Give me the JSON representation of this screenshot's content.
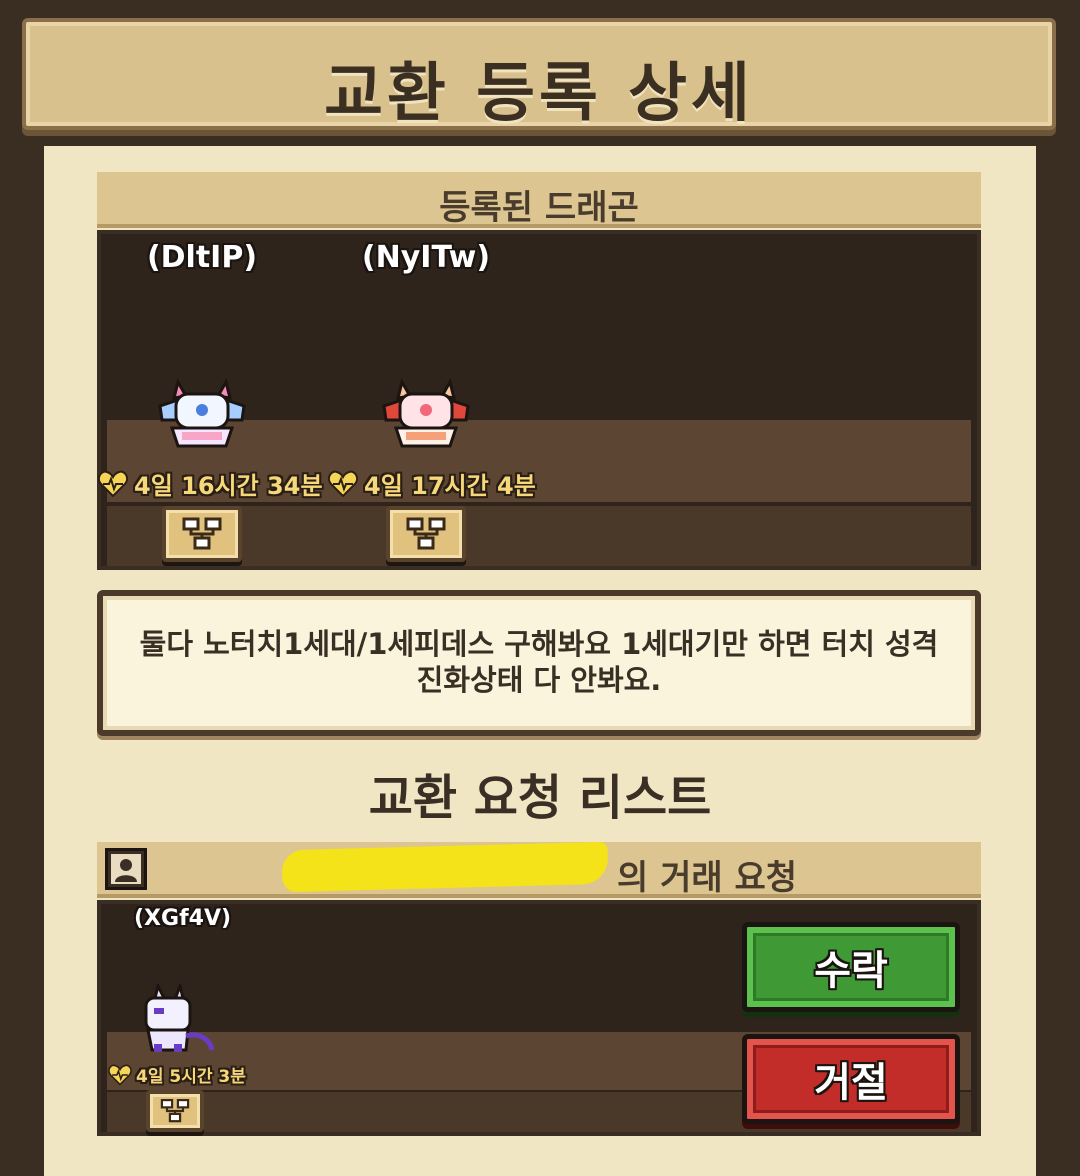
{
  "header": {
    "title": "교환 등록 상세"
  },
  "registered": {
    "section_label": "등록된 드래곤",
    "dragons": [
      {
        "name": "(DltIP)",
        "time": "4일 16시간 34분",
        "palette": "blue"
      },
      {
        "name": "(NyITw)",
        "time": "4일 17시간 4분",
        "palette": "red"
      }
    ]
  },
  "memo": {
    "text": "둘다 노터치1세대/1세피데스 구해봐요 1세대기만 하면 터치 성격 진화상태 다 안봐요."
  },
  "request_list": {
    "title": "교환 요청 리스트",
    "request": {
      "from_suffix": "의 거래 요청",
      "dragon_name": "(XGf4V)",
      "time": "4일 5시간 3분",
      "accept_label": "수락",
      "reject_label": "거절"
    }
  },
  "colors": {
    "accept": "#3f9a35",
    "reject": "#c22d2a",
    "gold_text": "#f6d77a",
    "panel": "#f1e6c4"
  },
  "icons": [
    "heart-icon",
    "family-tree-icon",
    "user-avatar-icon"
  ]
}
